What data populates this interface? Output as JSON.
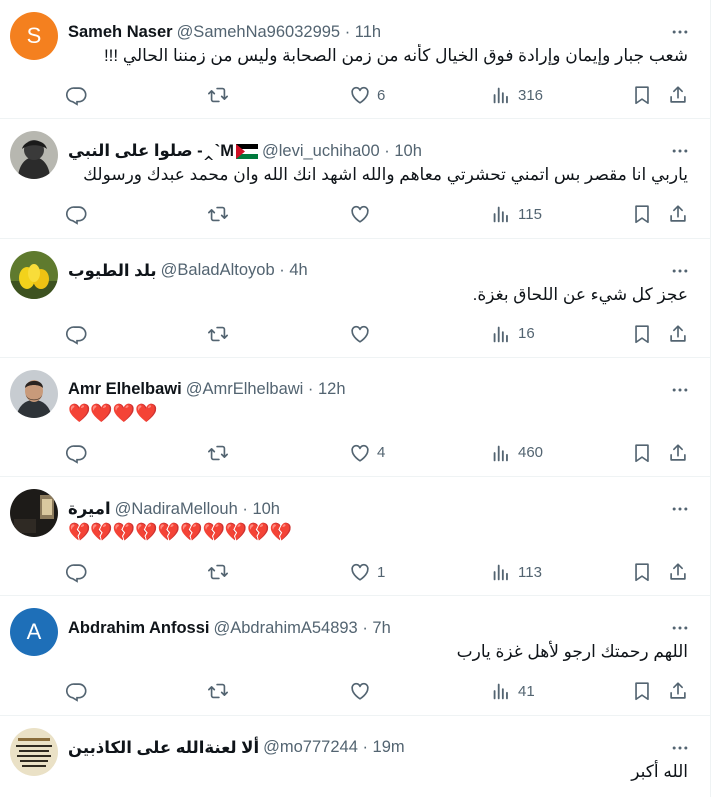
{
  "colors": {
    "text": "#0f1419",
    "secondary": "#536471",
    "divider": "#eff3f4"
  },
  "icons": {
    "reply": "reply-icon",
    "repost": "repost-icon",
    "like": "like-icon",
    "views": "views-icon",
    "bookmark": "bookmark-icon",
    "share": "share-icon",
    "more": "more-icon"
  },
  "tweets": [
    {
      "avatar": {
        "type": "letter",
        "letter": "S",
        "bg": "#f4801f"
      },
      "name": "Sameh Naser",
      "handle": "@SamehNa96032995",
      "time": "11h",
      "text": "شعب جبار وإيمان وإرادة فوق الخيال كأنه من زمن الصحابة وليس من زمننا الحالي !!!",
      "dir": "rtl",
      "likes": "6",
      "views": "316"
    },
    {
      "avatar": {
        "type": "photo"
      },
      "name": "صلوا على النبي ‎-‸`‎M",
      "handle": "@levi_uchiha00",
      "time": "10h",
      "flag": true,
      "text": "ياربي انا مقصر بس اتمني تحشرتي معاهم والله اشهد انك الله وان محمد عبدك ورسولك",
      "dir": "rtl",
      "likes": "",
      "views": "115"
    },
    {
      "avatar": {
        "type": "photo"
      },
      "name": "بلد الطيوب",
      "handle": "@BaladAltoyob",
      "time": "4h",
      "text": "عجز كل شيء عن اللحاق بغزة.",
      "dir": "rtl",
      "likes": "",
      "views": "16"
    },
    {
      "avatar": {
        "type": "photo"
      },
      "name": "Amr Elhelbawi",
      "handle": "@AmrElhelbawi",
      "time": "12h",
      "text": "❤️❤️❤️❤️",
      "dir": "ltr",
      "emoji": true,
      "likes": "4",
      "views": "460"
    },
    {
      "avatar": {
        "type": "photo"
      },
      "name": "اميرة",
      "handle": "@NadiraMellouh",
      "time": "10h",
      "text": "💔💔💔💔💔💔💔💔💔💔",
      "dir": "ltr",
      "emoji": true,
      "likes": "1",
      "views": "113"
    },
    {
      "avatar": {
        "type": "letter",
        "letter": "A",
        "bg": "#1e6fb8"
      },
      "name": "Abdrahim Anfossi",
      "handle": "@AbdrahimA54893",
      "time": "7h",
      "text": "اللهم رحمتك ارجو لأهل غزة يارب",
      "dir": "rtl",
      "likes": "",
      "views": "41"
    },
    {
      "avatar": {
        "type": "photo"
      },
      "name": "ألا لعنةالله على الكاذبين",
      "handle": "@mo777244",
      "time": "19m",
      "text": "الله أكبر",
      "dir": "rtl",
      "likes": "",
      "views": ""
    }
  ]
}
